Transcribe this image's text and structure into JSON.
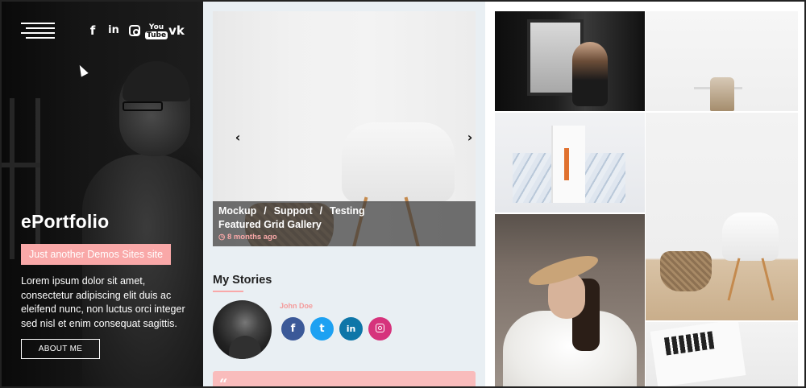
{
  "left": {
    "brand": "ePortfolio",
    "tagline": "Just another Demos Sites site",
    "intro": "Lorem ipsum dolor sit amet, consectetur adipiscing elit duis ac eleifend nunc, non luctus orci integer sed nisl et enim consequat sagittis.",
    "about_button": "ABOUT ME",
    "social_icons": [
      "facebook-icon",
      "linkedin-icon",
      "instagram-icon",
      "youtube-icon",
      "vk-icon"
    ],
    "social_glyphs": {
      "facebook": "f",
      "linkedin": "in",
      "youtube_top": "You",
      "youtube_bottom": "Tube",
      "vk": "vk"
    }
  },
  "slider": {
    "categories": [
      "Mockup",
      "Support",
      "Testing"
    ],
    "separator": "/",
    "title": "Featured Grid Gallery",
    "date": "8 months ago",
    "date_icon": "clock-icon",
    "prev_glyph": "‹",
    "next_glyph": "›"
  },
  "stories": {
    "title": "My Stories",
    "author": "John Doe",
    "share_glyphs": {
      "facebook": "f",
      "twitter": "t",
      "linkedin": "in"
    },
    "quote_glyph": "“"
  },
  "colors": {
    "accent": "#f9a8a8",
    "dark_panel": "#111111",
    "middle_bg": "#e9eff3",
    "facebook": "#3b5998",
    "twitter": "#1da1f2",
    "linkedin": "#0e76a8",
    "instagram": "#d6337c"
  }
}
